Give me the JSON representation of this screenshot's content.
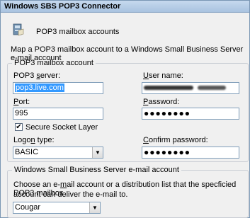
{
  "window": {
    "title": "Windows SBS POP3 Connector"
  },
  "header": {
    "title": "POP3 mailbox accounts",
    "icon": "mailbox-icon"
  },
  "intro": "Map a POP3 mailbox account to a Windows Small Business Server e-mail account",
  "pop3_group": {
    "legend": "POP3 mailbox account",
    "server": {
      "label_pre": "POP3 ",
      "label_u": "s",
      "label_post": "erver:",
      "value": "pop3.live.com"
    },
    "port": {
      "label_u": "P",
      "label_post": "ort:",
      "value": "995"
    },
    "ssl": {
      "label": "Secure Socket Layer",
      "checked": true
    },
    "logon": {
      "label_pre": "Logo",
      "label_u": "n",
      "label_post": " type:",
      "value": "BASIC"
    },
    "username": {
      "label_u": "U",
      "label_post": "ser name:"
    },
    "password": {
      "label_u": "P",
      "label_post": "assword:",
      "value": "●●●●●●●●"
    },
    "confirm": {
      "label_u": "C",
      "label_post": "onfirm password:",
      "value": "●●●●●●●●"
    }
  },
  "sbs_group": {
    "legend": "Windows Small Business Server e-mail account",
    "desc_line1_pre": "Choose an e-",
    "desc_line1_u": "m",
    "desc_line1_post": "ail account or a distribution list that the specficied POP3 mailbox",
    "desc_line2": "account can deliver the e-mail to.",
    "account_value": "Cougar"
  }
}
